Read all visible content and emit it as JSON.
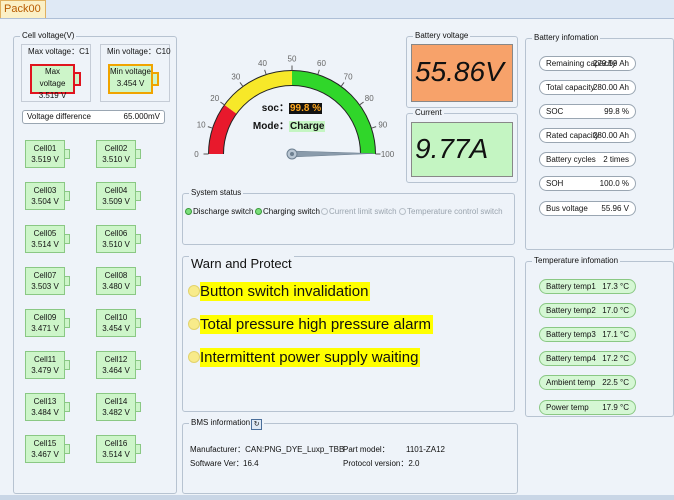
{
  "tab": {
    "label": "Pack00"
  },
  "cell_voltage": {
    "title": "Cell voltage(V)",
    "max_caption": "Max voltage：C1",
    "min_caption": "Min voltage：C10",
    "max_label": "Max voltage",
    "max_value": "3.519 V",
    "min_label": "Min voltage",
    "min_value": "3.454 V",
    "diff_label": "Voltage difference",
    "diff_value": "65.000mV",
    "cells": [
      {
        "name": "Cell01",
        "value": "3.519 V"
      },
      {
        "name": "Cell02",
        "value": "3.510 V"
      },
      {
        "name": "Cell03",
        "value": "3.504 V"
      },
      {
        "name": "Cell04",
        "value": "3.509 V"
      },
      {
        "name": "Cell05",
        "value": "3.514 V"
      },
      {
        "name": "Cell06",
        "value": "3.510 V"
      },
      {
        "name": "Cell07",
        "value": "3.503 V"
      },
      {
        "name": "Cell08",
        "value": "3.480 V"
      },
      {
        "name": "Cell09",
        "value": "3.471 V"
      },
      {
        "name": "Cell10",
        "value": "3.454 V"
      },
      {
        "name": "Cell11",
        "value": "3.479 V"
      },
      {
        "name": "Cell12",
        "value": "3.464 V"
      },
      {
        "name": "Cell13",
        "value": "3.484 V"
      },
      {
        "name": "Cell14",
        "value": "3.482 V"
      },
      {
        "name": "Cell15",
        "value": "3.467 V"
      },
      {
        "name": "Cell16",
        "value": "3.514 V"
      }
    ]
  },
  "gauge": {
    "ticks": [
      "0",
      "10",
      "20",
      "30",
      "40",
      "50",
      "60",
      "70",
      "80",
      "90",
      "100"
    ],
    "value": 99.8,
    "soc_label": "soc：",
    "soc_value": "99.8 %",
    "mode_label": "Mode：",
    "mode_value": "Charge",
    "colors": {
      "red": "#e8192c",
      "yellow": "#f7e829",
      "green": "#30d62a"
    }
  },
  "battery_voltage": {
    "title": "Battery voltage",
    "value": "55.86V",
    "color": "#f7a26a"
  },
  "current": {
    "title": "Current",
    "value": "9.77A",
    "color": "#c4f5c2"
  },
  "system_status": {
    "title": "System status",
    "items": [
      {
        "label": "Discharge switch",
        "on": true
      },
      {
        "label": "Charging switch",
        "on": true
      },
      {
        "label": "Current limit switch",
        "on": false
      },
      {
        "label": "Temperature control switch",
        "on": false
      }
    ]
  },
  "warn": {
    "title": "Warn and Protect",
    "items": [
      "Button switch invalidation",
      "Total pressure high pressure alarm",
      "Intermittent power supply waiting"
    ]
  },
  "bms": {
    "title": "BMS information",
    "manufacturer_label": "Manufacturer：",
    "manufacturer_value": "CAN:PNG_DYE_Luxp_TBB",
    "part_label": "Part model：",
    "part_value": "1101-ZA12",
    "software_label": "Software Ver：",
    "software_value": "16.4",
    "protocol_label": "Protocol version：",
    "protocol_value": "2.0"
  },
  "battery_info": {
    "title": "Battery infomation",
    "items": [
      {
        "label": "Remaining capacity",
        "value": "279.59 Ah"
      },
      {
        "label": "Total capacity",
        "value": "280.00 Ah"
      },
      {
        "label": "SOC",
        "value": "99.8 %"
      },
      {
        "label": "Rated capacity",
        "value": "280.00 Ah"
      },
      {
        "label": "Battery cycles",
        "value": "2 times"
      },
      {
        "label": "SOH",
        "value": "100.0 %"
      },
      {
        "label": "Bus voltage",
        "value": "55.96 V"
      }
    ]
  },
  "temperature": {
    "title": "Temperature infomation",
    "items": [
      {
        "label": "Battery temp1",
        "value": "17.3 °C"
      },
      {
        "label": "Battery temp2",
        "value": "17.0 °C"
      },
      {
        "label": "Battery temp3",
        "value": "17.1 °C"
      },
      {
        "label": "Battery temp4",
        "value": "17.2 °C"
      },
      {
        "label": "Ambient temp",
        "value": "22.5 °C"
      },
      {
        "label": "Power temp",
        "value": "17.9 °C"
      }
    ]
  }
}
